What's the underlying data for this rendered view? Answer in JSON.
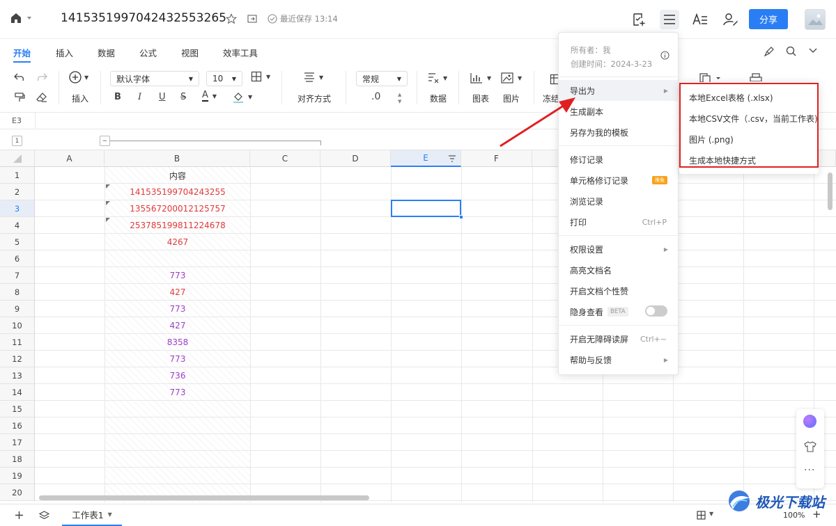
{
  "doc": {
    "title": "141535199704243255326​5",
    "save_status": "最近保存 13:14"
  },
  "header": {
    "share_label": "分享"
  },
  "tabs": [
    "开始",
    "插入",
    "数据",
    "公式",
    "视图",
    "效率工具"
  ],
  "toolbar": {
    "insert_label": "插入",
    "font_name": "默认字体",
    "font_size": "10",
    "align_label": "对齐方式",
    "number_format": "常规",
    "decimal_label": ".0",
    "data_label": "数据",
    "chart_label": "图表",
    "image_label": "图片",
    "freeze_label": "冻结"
  },
  "formula_bar": {
    "cell_ref": "E3"
  },
  "grid": {
    "group_level": "1",
    "columns": [
      "A",
      "B",
      "C",
      "D",
      "E",
      "F"
    ],
    "rows": [
      "1",
      "2",
      "3",
      "4",
      "5",
      "6",
      "7",
      "8",
      "9",
      "10",
      "11",
      "12",
      "13",
      "14",
      "15",
      "16",
      "17",
      "18",
      "19",
      "20"
    ],
    "b_cells": [
      {
        "row": 1,
        "text": "内容",
        "color": "#333333"
      },
      {
        "row": 2,
        "text": "141535199704243255",
        "color": "#e03a3a"
      },
      {
        "row": 3,
        "text": "135567200012125757",
        "color": "#e03a3a"
      },
      {
        "row": 4,
        "text": "253785199811224678",
        "color": "#e03a3a"
      },
      {
        "row": 5,
        "text": "4267",
        "color": "#e03a3a"
      },
      {
        "row": 7,
        "text": "773",
        "color": "#9b3ec8"
      },
      {
        "row": 8,
        "text": "427",
        "color": "#e03a3a"
      },
      {
        "row": 9,
        "text": "773",
        "color": "#9b3ec8"
      },
      {
        "row": 10,
        "text": "427",
        "color": "#9b3ec8"
      },
      {
        "row": 11,
        "text": "8358",
        "color": "#9b3ec8"
      },
      {
        "row": 12,
        "text": "773",
        "color": "#9b3ec8"
      },
      {
        "row": 13,
        "text": "736",
        "color": "#9b3ec8"
      },
      {
        "row": 14,
        "text": "773",
        "color": "#9b3ec8"
      }
    ]
  },
  "bottom": {
    "sheet_name": "工作表1",
    "zoom": "100%"
  },
  "menu": {
    "owner": "所有者：我",
    "created": "创建时间：2024-3-23",
    "items": [
      {
        "label": "导出为",
        "arrow": "▶"
      },
      {
        "label": "生成副本"
      },
      {
        "label": "另存为我的模板"
      },
      {
        "label": "修订记录"
      },
      {
        "label": "单元格修订记录",
        "badge": "限免"
      },
      {
        "label": "浏览记录"
      },
      {
        "label": "打印",
        "shortcut": "Ctrl+P"
      },
      {
        "label": "权限设置",
        "arrow": "▶"
      },
      {
        "label": "高亮文档名"
      },
      {
        "label": "开启文档个性赞"
      },
      {
        "label": "隐身查看",
        "badge": "BETA"
      },
      {
        "label": "开启无障碍读屏",
        "shortcut": "Ctrl+~"
      },
      {
        "label": "帮助与反馈",
        "arrow": "▶"
      }
    ]
  },
  "submenu": {
    "items": [
      "本地Excel表格 (.xlsx)",
      "本地CSV文件（.csv，当前工作表)",
      "图片 (.png)",
      "生成本地快捷方式"
    ]
  },
  "watermark": "极光下载站"
}
